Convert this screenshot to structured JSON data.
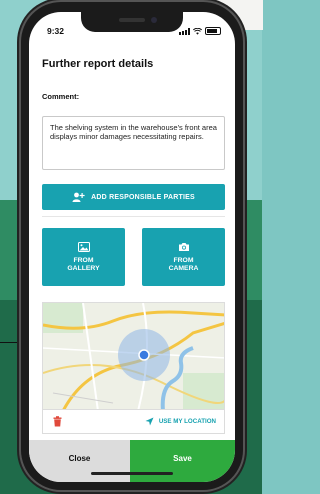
{
  "status_bar": {
    "time": "9:32"
  },
  "title": "Further report details",
  "comment": {
    "label": "Comment:",
    "value": "The shelving system in the warehouse's front area displays minor damages necessitating repairs."
  },
  "add_parties_label": "ADD RESPONSIBLE PARTIES",
  "tiles": {
    "gallery_label": "FROM\nGALLERY",
    "camera_label": "FROM\nCAMERA"
  },
  "map": {
    "use_location_label": "USE MY LOCATION"
  },
  "footer": {
    "close_label": "Close",
    "save_label": "Save"
  },
  "colors": {
    "accent": "#18a2b0",
    "save": "#2eaa3e",
    "close_bg": "#dcdcdc",
    "trash": "#e0493b"
  },
  "icons": [
    "add-user-icon",
    "image-icon",
    "camera-icon",
    "trash-icon",
    "location-arrow-icon"
  ]
}
